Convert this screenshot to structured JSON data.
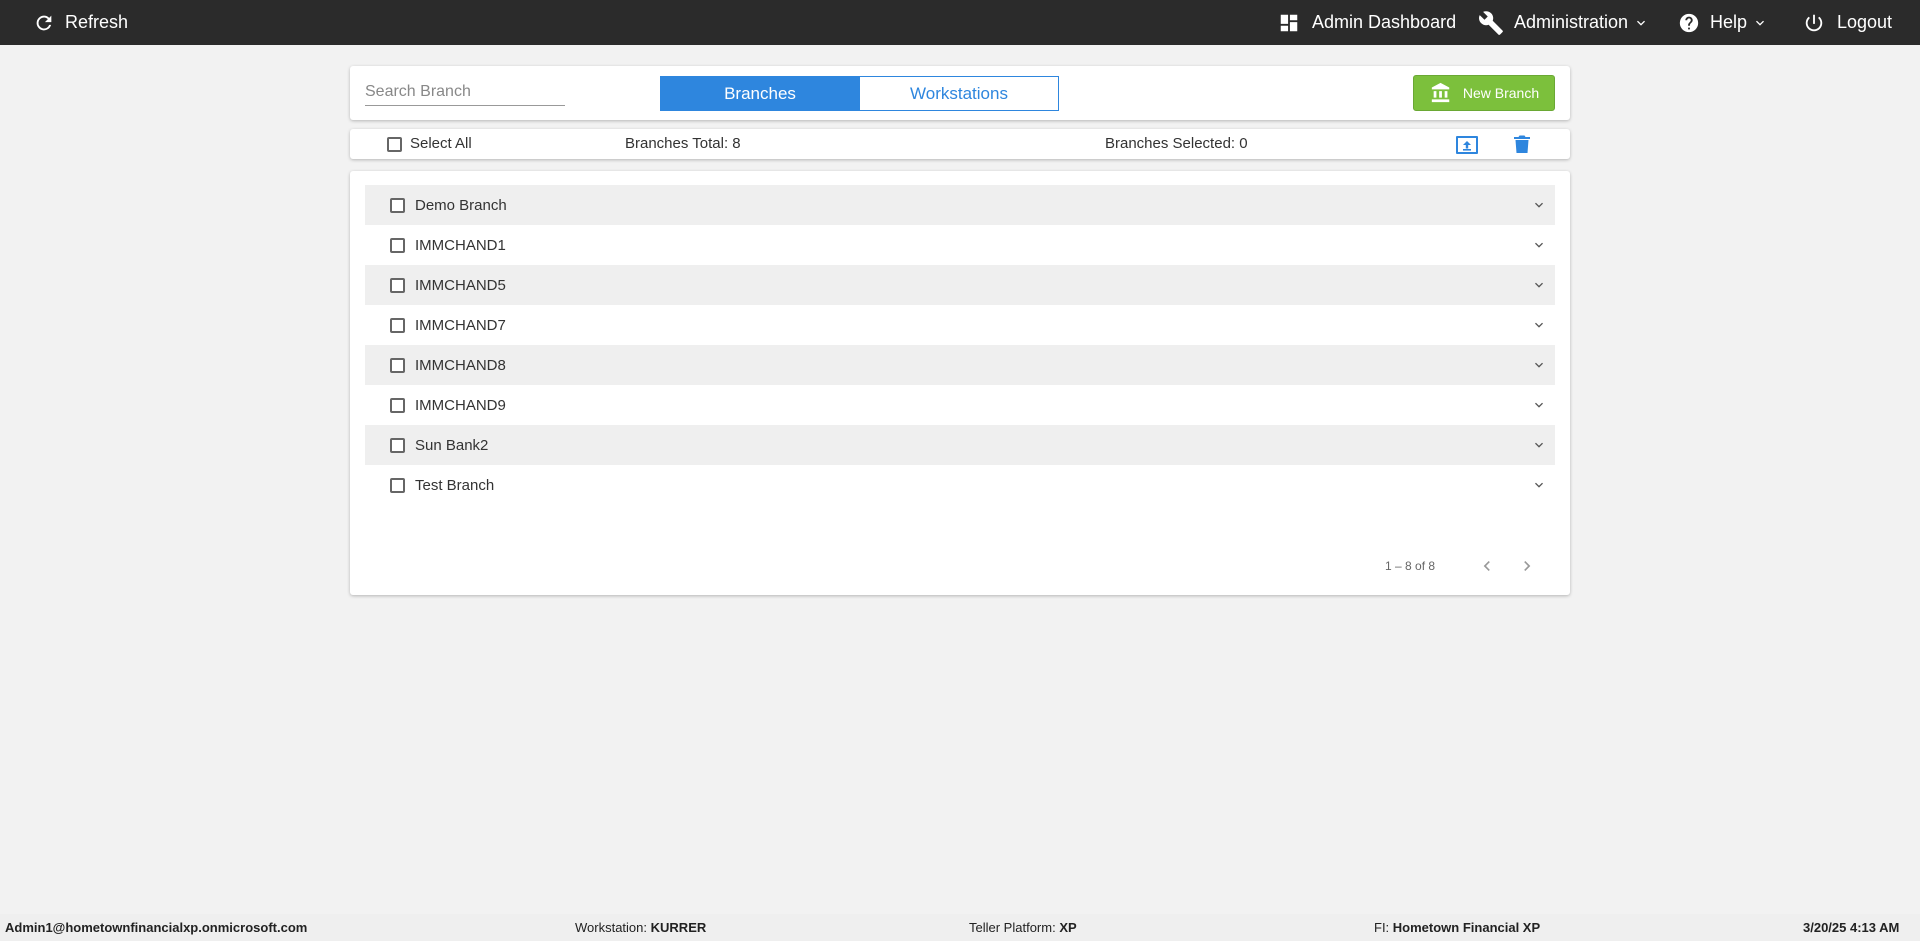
{
  "topbar": {
    "refresh_label": "Refresh",
    "dashboard_label": "Admin Dashboard",
    "administration_label": "Administration",
    "help_label": "Help",
    "logout_label": "Logout"
  },
  "toolbar": {
    "search_placeholder": "Search Branch",
    "tabs": [
      {
        "label": "Branches",
        "active": true
      },
      {
        "label": "Workstations",
        "active": false
      }
    ],
    "new_branch_label": "New Branch"
  },
  "summary": {
    "select_all_label": "Select All",
    "total_label": "Branches Total: 8",
    "selected_label": "Branches Selected: 0"
  },
  "branches": [
    {
      "name": "Demo Branch"
    },
    {
      "name": "IMMCHAND1"
    },
    {
      "name": "IMMCHAND5"
    },
    {
      "name": "IMMCHAND7"
    },
    {
      "name": "IMMCHAND8"
    },
    {
      "name": "IMMCHAND9"
    },
    {
      "name": "Sun Bank2"
    },
    {
      "name": "Test Branch"
    }
  ],
  "pagination": {
    "range_label": "1 – 8 of 8"
  },
  "footer": {
    "user": "Admin1@hometownfinancialxp.onmicrosoft.com",
    "workstation_label": "Workstation:",
    "workstation_value": "KURRER",
    "platform_label": "Teller Platform:",
    "platform_value": "XP",
    "fi_label": "FI:",
    "fi_value": "Hometown Financial XP",
    "datetime": "3/20/25 4:13 AM"
  },
  "colors": {
    "topbar_bg": "#2b2b2b",
    "accent_blue": "#2e86de",
    "new_branch_green": "#7cc03c",
    "page_bg": "#f2f2f2"
  },
  "icons": {
    "refresh": "refresh-icon",
    "dashboard": "dashboard-icon",
    "administration": "wrench-icon",
    "help": "help-circle-icon",
    "logout": "power-icon",
    "new_branch": "bank-icon",
    "upload": "upload-icon",
    "delete": "trash-icon",
    "expand": "chevron-down-icon"
  }
}
